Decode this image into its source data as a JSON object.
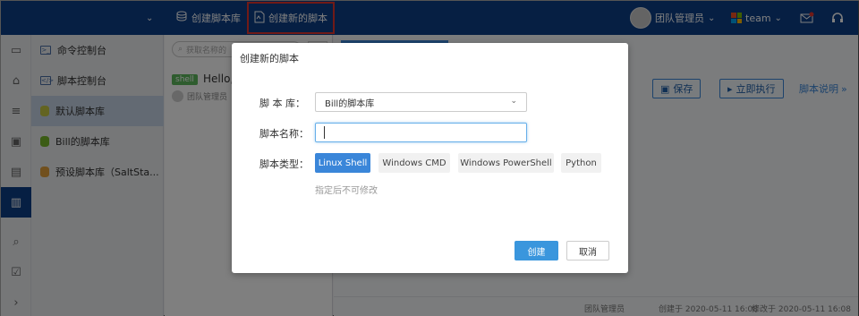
{
  "topbar": {
    "create_lib_label": "创建脚本库",
    "create_script_label": "创建新的脚本",
    "user_label": "团队管理员",
    "team_label": "team"
  },
  "sidebar": {
    "items": [
      {
        "label": "命令控制台"
      },
      {
        "label": "脚本控制台"
      },
      {
        "label": "默认脚本库"
      },
      {
        "label": "Bill的脚本库"
      },
      {
        "label": "预设脚本库（SaltSta..."
      }
    ]
  },
  "midpanel": {
    "search_placeholder": "获取名称的",
    "script": {
      "badge": "shell",
      "title": "Hello,V",
      "owner": "团队管理员"
    }
  },
  "editor": {
    "save_label": "保存",
    "run_label": "立即执行",
    "docs_label": "脚本说明",
    "footer": {
      "owner": "团队管理员",
      "created": "创建于 2020-05-11 16:08",
      "modified": "修改于 2020-05-11 16:08"
    }
  },
  "modal": {
    "title": "创建新的脚本",
    "lib_label": "脚 本 库：",
    "lib_value": "Bill的脚本库",
    "name_label": "脚本名称：",
    "name_value": "",
    "type_label": "脚本类型：",
    "types": [
      "Linux Shell",
      "Windows CMD",
      "Windows PowerShell",
      "Python"
    ],
    "selected_type": "Linux Shell",
    "hint": "指定后不可修改",
    "create_label": "创建",
    "cancel_label": "取消"
  },
  "colors": {
    "topbar": "#0d3e86",
    "accent": "#3a86d9",
    "highlight": "#e0342f"
  }
}
